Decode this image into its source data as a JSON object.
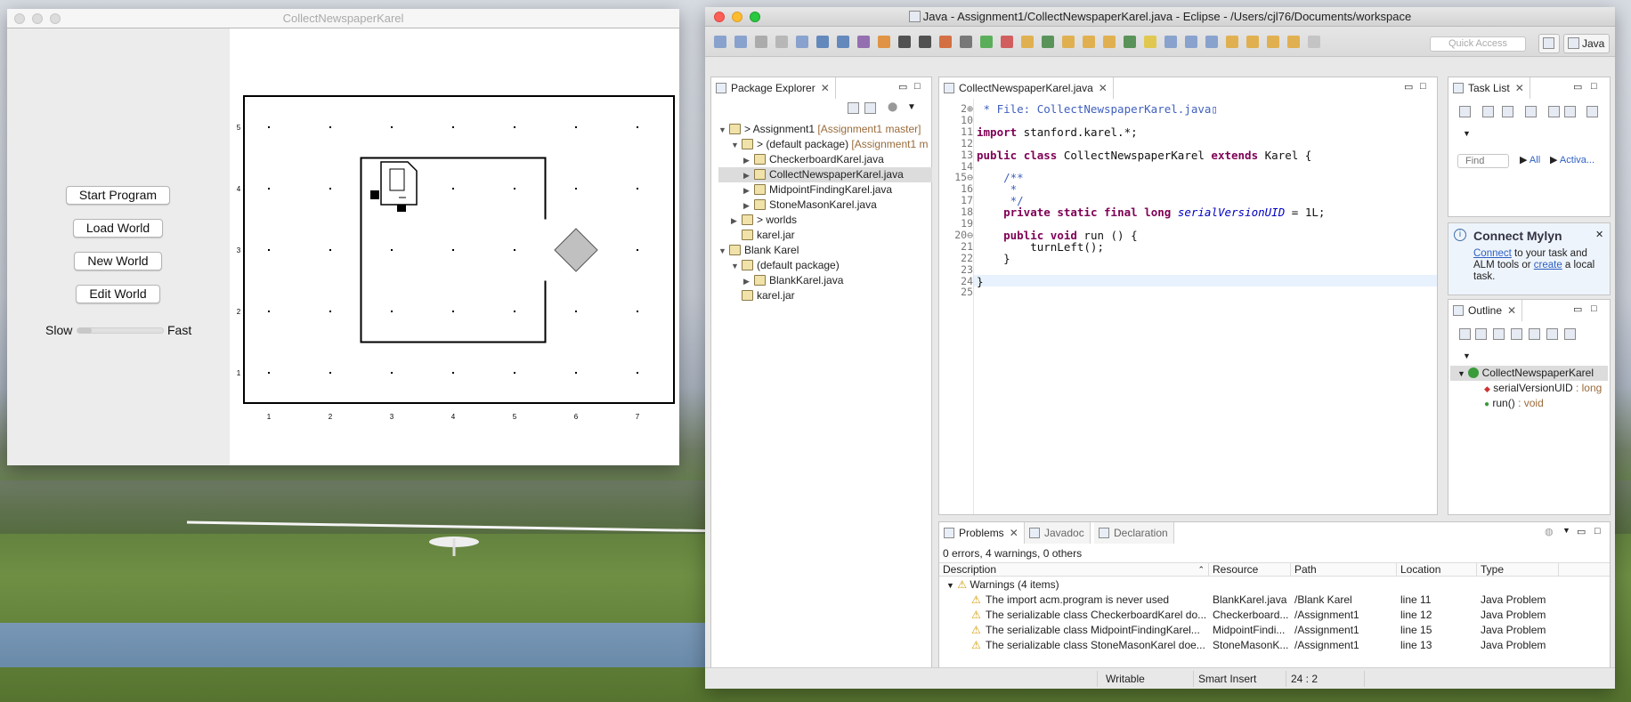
{
  "karel_window": {
    "title": "CollectNewspaperKarel",
    "buttons": {
      "start": "Start Program",
      "load": "Load World",
      "new": "New World",
      "edit": "Edit World"
    },
    "speed": {
      "slow": "Slow",
      "fast": "Fast",
      "value": 0.0
    },
    "world": {
      "cols": 7,
      "rows": 5,
      "col_labels": [
        "1",
        "2",
        "3",
        "4",
        "5",
        "6",
        "7"
      ],
      "row_labels": [
        "5",
        "4",
        "3",
        "2",
        "1"
      ],
      "karel": {
        "col": 3,
        "row": 4,
        "facing": "east"
      },
      "beeper": {
        "col": 6,
        "row": 3
      }
    }
  },
  "eclipse": {
    "title": "Java - Assignment1/CollectNewspaperKarel.java - Eclipse - /Users/cjl76/Documents/workspace",
    "quick_access": "Quick Access",
    "perspective": "Java",
    "package_explorer": {
      "tab": "Package Explorer",
      "tree": [
        {
          "label": "> Assignment1",
          "decor": "[Assignment1 master]",
          "indent": 0,
          "arrow": "▼"
        },
        {
          "label": "> (default package)",
          "decor": "[Assignment1 m",
          "indent": 1,
          "arrow": "▼"
        },
        {
          "label": "CheckerboardKarel.java",
          "decor": "",
          "indent": 2,
          "arrow": "▶"
        },
        {
          "label": "CollectNewspaperKarel.java",
          "decor": "",
          "indent": 2,
          "arrow": "▶",
          "selected": true
        },
        {
          "label": "MidpointFindingKarel.java",
          "decor": "",
          "indent": 2,
          "arrow": "▶"
        },
        {
          "label": "StoneMasonKarel.java",
          "decor": "",
          "indent": 2,
          "arrow": "▶"
        },
        {
          "label": "> worlds",
          "decor": "",
          "indent": 1,
          "arrow": "▶"
        },
        {
          "label": "karel.jar",
          "decor": "",
          "indent": 1,
          "arrow": ""
        },
        {
          "label": "Blank Karel",
          "decor": "",
          "indent": 0,
          "arrow": "▼"
        },
        {
          "label": "(default package)",
          "decor": "",
          "indent": 1,
          "arrow": "▼"
        },
        {
          "label": "BlankKarel.java",
          "decor": "",
          "indent": 2,
          "arrow": "▶"
        },
        {
          "label": "karel.jar",
          "decor": "",
          "indent": 1,
          "arrow": ""
        }
      ]
    },
    "editor": {
      "tab": "CollectNewspaperKarel.java",
      "lines": [
        {
          "n": "2⊕",
          "t": " * File: CollectNewspaperKarel.java▯",
          "cls": "cm"
        },
        {
          "n": "10",
          "t": "",
          "cls": ""
        },
        {
          "n": "11",
          "t": "import stanford.karel.*;",
          "cls": ""
        },
        {
          "n": "12",
          "t": "",
          "cls": ""
        },
        {
          "n": "13",
          "t": "public class CollectNewspaperKarel extends Karel {",
          "cls": ""
        },
        {
          "n": "14",
          "t": "",
          "cls": ""
        },
        {
          "n": "15⊖",
          "t": "    /**",
          "cls": "cm"
        },
        {
          "n": "16",
          "t": "     *",
          "cls": "cm"
        },
        {
          "n": "17",
          "t": "     */",
          "cls": "cm"
        },
        {
          "n": "18",
          "t": "    private static final long serialVersionUID = 1L;",
          "cls": ""
        },
        {
          "n": "19",
          "t": "",
          "cls": ""
        },
        {
          "n": "20⊖",
          "t": "    public void run () {",
          "cls": ""
        },
        {
          "n": "21",
          "t": "        turnLeft();",
          "cls": ""
        },
        {
          "n": "22",
          "t": "    }",
          "cls": ""
        },
        {
          "n": "23",
          "t": "",
          "cls": ""
        },
        {
          "n": "24",
          "t": "}",
          "cls": "",
          "current": true
        },
        {
          "n": "25",
          "t": "",
          "cls": ""
        }
      ]
    },
    "task_list": {
      "tab": "Task List",
      "find_placeholder": "Find",
      "all": "All",
      "activate": "Activa..."
    },
    "mylyn": {
      "title": "Connect Mylyn",
      "link1": "Connect",
      "text1": " to your task and ALM tools or ",
      "link2": "create",
      "text2": " a local task."
    },
    "outline": {
      "tab": "Outline",
      "class_name": "CollectNewspaperKarel",
      "field": "serialVersionUID",
      "field_type": " : long",
      "method": "run()",
      "method_type": " : void"
    },
    "problems": {
      "tabs": [
        "Problems",
        "Javadoc",
        "Declaration"
      ],
      "summary": "0 errors, 4 warnings, 0 others",
      "columns": [
        "Description",
        "Resource",
        "Path",
        "Location",
        "Type"
      ],
      "group": "Warnings (4 items)",
      "rows": [
        [
          "The import acm.program is never used",
          "BlankKarel.java",
          "/Blank Karel",
          "line 11",
          "Java Problem"
        ],
        [
          "The serializable class CheckerboardKarel do...",
          "Checkerboard...",
          "/Assignment1",
          "line 12",
          "Java Problem"
        ],
        [
          "The serializable class MidpointFindingKarel...",
          "MidpointFindi...",
          "/Assignment1",
          "line 15",
          "Java Problem"
        ],
        [
          "The serializable class StoneMasonKarel doe...",
          "StoneMasonK...",
          "/Assignment1",
          "line 13",
          "Java Problem"
        ]
      ]
    },
    "status": {
      "writable": "Writable",
      "insert": "Smart Insert",
      "position": "24 : 2"
    }
  }
}
